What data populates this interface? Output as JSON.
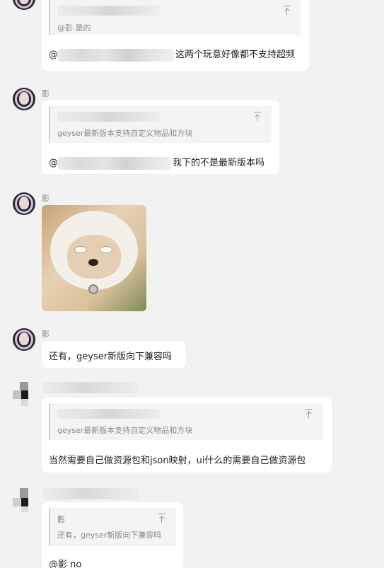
{
  "messages": [
    {
      "quote_name": "@影 是的",
      "text": "这两个玩意好像都不支持超频"
    },
    {
      "sender": "影",
      "quote_text": "geyser最新版本支持自定义物品和方块",
      "text": "我下的不是最新版本吗"
    },
    {
      "sender": "影",
      "image": "sticker-image"
    },
    {
      "sender": "影",
      "text": "还有，geyser新版向下兼容吗"
    },
    {
      "quote_text": "geyser最新版本支持自定义物品和方块",
      "text": "当然需要自己做资源包和json映射，ui什么的需要自己做资源包"
    },
    {
      "quote_name": "影",
      "quote_text": "还有，geyser新版向下兼容吗",
      "text": "@影 no"
    }
  ],
  "at_symbol": "@",
  "icons": {
    "pin": "pin-top-icon"
  }
}
